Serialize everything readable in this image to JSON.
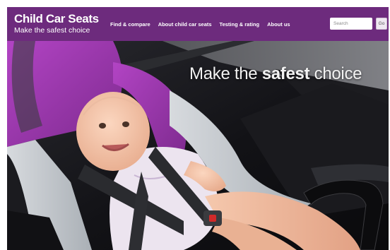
{
  "header": {
    "logo_name": "Child Car Seats",
    "logo_tagline": "Make the safest choice",
    "background_color": "#6d2b7d"
  },
  "nav": {
    "items": [
      {
        "label": "Find & compare"
      },
      {
        "label": "About child car seats"
      },
      {
        "label": "Testing & rating"
      },
      {
        "label": "About us"
      }
    ]
  },
  "search": {
    "placeholder": "Search",
    "button_label": "Go"
  },
  "hero": {
    "headline_before": "Make the ",
    "headline_emphasis": "safest",
    "headline_after": " choice",
    "image_subject": "baby-in-car-seat-photo"
  }
}
